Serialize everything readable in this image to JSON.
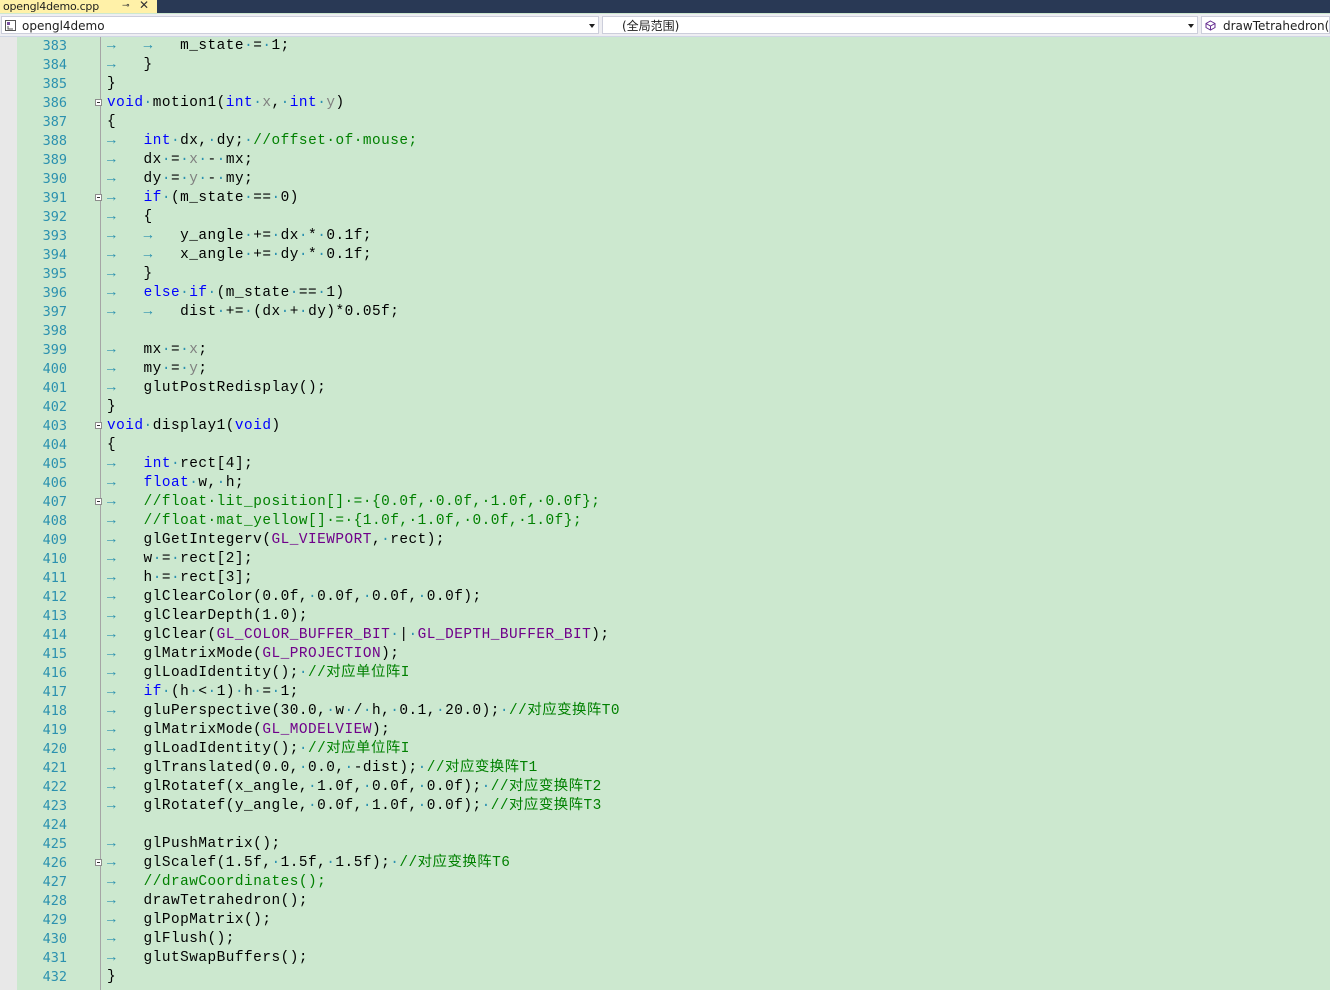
{
  "tab": {
    "title": "opengl4demo.cpp",
    "pin_icon": "⊸",
    "close_icon": "✕"
  },
  "nav": {
    "project": "opengl4demo",
    "scope": "(全局范围)",
    "member": "drawTetrahedron(void)"
  },
  "colors": {
    "background": "#cce8cf",
    "keyword": "#0000ff",
    "comment": "#008000",
    "macro": "#6f008a",
    "line_number": "#2b91af"
  },
  "lines": [
    {
      "n": "383",
      "fold": false,
      "seg": [
        [
          "ar",
          "→"
        ],
        [
          "t",
          "   "
        ],
        [
          "ar",
          "→"
        ],
        [
          "t",
          "   m_state"
        ],
        [
          "dt",
          "·"
        ],
        [
          "t",
          "="
        ],
        [
          "dt",
          "·"
        ],
        [
          "t",
          "1;"
        ]
      ]
    },
    {
      "n": "384",
      "fold": false,
      "seg": [
        [
          "ar",
          "→"
        ],
        [
          "t",
          "   }"
        ]
      ]
    },
    {
      "n": "385",
      "fold": false,
      "seg": [
        [
          "t",
          "}"
        ]
      ]
    },
    {
      "n": "386",
      "fold": true,
      "seg": [
        [
          "kw",
          "void"
        ],
        [
          "dt",
          "·"
        ],
        [
          "t",
          "motion1("
        ],
        [
          "kw",
          "int"
        ],
        [
          "dt",
          "·"
        ],
        [
          "par",
          "x"
        ],
        [
          "t",
          ","
        ],
        [
          "dt",
          "·"
        ],
        [
          "kw",
          "int"
        ],
        [
          "dt",
          "·"
        ],
        [
          "par",
          "y"
        ],
        [
          "t",
          ")"
        ]
      ]
    },
    {
      "n": "387",
      "fold": false,
      "seg": [
        [
          "t",
          "{"
        ]
      ]
    },
    {
      "n": "388",
      "fold": false,
      "seg": [
        [
          "ar",
          "→"
        ],
        [
          "t",
          "   "
        ],
        [
          "kw",
          "int"
        ],
        [
          "dt",
          "·"
        ],
        [
          "t",
          "dx,"
        ],
        [
          "dt",
          "·"
        ],
        [
          "t",
          "dy;"
        ],
        [
          "dt",
          "·"
        ],
        [
          "cm",
          "//offset·of·mouse;"
        ]
      ]
    },
    {
      "n": "389",
      "fold": false,
      "seg": [
        [
          "ar",
          "→"
        ],
        [
          "t",
          "   dx"
        ],
        [
          "dt",
          "·"
        ],
        [
          "t",
          "="
        ],
        [
          "dt",
          "·"
        ],
        [
          "par",
          "x"
        ],
        [
          "dt",
          "·"
        ],
        [
          "t",
          "-"
        ],
        [
          "dt",
          "·"
        ],
        [
          "t",
          "mx;"
        ]
      ]
    },
    {
      "n": "390",
      "fold": false,
      "seg": [
        [
          "ar",
          "→"
        ],
        [
          "t",
          "   dy"
        ],
        [
          "dt",
          "·"
        ],
        [
          "t",
          "="
        ],
        [
          "dt",
          "·"
        ],
        [
          "par",
          "y"
        ],
        [
          "dt",
          "·"
        ],
        [
          "t",
          "-"
        ],
        [
          "dt",
          "·"
        ],
        [
          "t",
          "my;"
        ]
      ]
    },
    {
      "n": "391",
      "fold": true,
      "seg": [
        [
          "ar",
          "→"
        ],
        [
          "t",
          "   "
        ],
        [
          "kw",
          "if"
        ],
        [
          "dt",
          "·"
        ],
        [
          "t",
          "(m_state"
        ],
        [
          "dt",
          "·"
        ],
        [
          "t",
          "=="
        ],
        [
          "dt",
          "·"
        ],
        [
          "t",
          "0)"
        ]
      ]
    },
    {
      "n": "392",
      "fold": false,
      "seg": [
        [
          "ar",
          "→"
        ],
        [
          "t",
          "   {"
        ]
      ]
    },
    {
      "n": "393",
      "fold": false,
      "seg": [
        [
          "ar",
          "→"
        ],
        [
          "t",
          "   "
        ],
        [
          "ar",
          "→"
        ],
        [
          "t",
          "   y_angle"
        ],
        [
          "dt",
          "·"
        ],
        [
          "t",
          "+="
        ],
        [
          "dt",
          "·"
        ],
        [
          "t",
          "dx"
        ],
        [
          "dt",
          "·"
        ],
        [
          "t",
          "*"
        ],
        [
          "dt",
          "·"
        ],
        [
          "t",
          "0.1f;"
        ]
      ]
    },
    {
      "n": "394",
      "fold": false,
      "seg": [
        [
          "ar",
          "→"
        ],
        [
          "t",
          "   "
        ],
        [
          "ar",
          "→"
        ],
        [
          "t",
          "   x_angle"
        ],
        [
          "dt",
          "·"
        ],
        [
          "t",
          "+="
        ],
        [
          "dt",
          "·"
        ],
        [
          "t",
          "dy"
        ],
        [
          "dt",
          "·"
        ],
        [
          "t",
          "*"
        ],
        [
          "dt",
          "·"
        ],
        [
          "t",
          "0.1f;"
        ]
      ]
    },
    {
      "n": "395",
      "fold": false,
      "seg": [
        [
          "ar",
          "→"
        ],
        [
          "t",
          "   }"
        ]
      ]
    },
    {
      "n": "396",
      "fold": false,
      "seg": [
        [
          "ar",
          "→"
        ],
        [
          "t",
          "   "
        ],
        [
          "kw",
          "else"
        ],
        [
          "dt",
          "·"
        ],
        [
          "kw",
          "if"
        ],
        [
          "dt",
          "·"
        ],
        [
          "t",
          "(m_state"
        ],
        [
          "dt",
          "·"
        ],
        [
          "t",
          "=="
        ],
        [
          "dt",
          "·"
        ],
        [
          "t",
          "1)"
        ]
      ]
    },
    {
      "n": "397",
      "fold": false,
      "seg": [
        [
          "ar",
          "→"
        ],
        [
          "t",
          "   "
        ],
        [
          "ar",
          "→"
        ],
        [
          "t",
          "   dist"
        ],
        [
          "dt",
          "·"
        ],
        [
          "t",
          "+="
        ],
        [
          "dt",
          "·"
        ],
        [
          "t",
          "(dx"
        ],
        [
          "dt",
          "·"
        ],
        [
          "t",
          "+"
        ],
        [
          "dt",
          "·"
        ],
        [
          "t",
          "dy)*0.05f;"
        ]
      ]
    },
    {
      "n": "398",
      "fold": false,
      "seg": []
    },
    {
      "n": "399",
      "fold": false,
      "seg": [
        [
          "ar",
          "→"
        ],
        [
          "t",
          "   mx"
        ],
        [
          "dt",
          "·"
        ],
        [
          "t",
          "="
        ],
        [
          "dt",
          "·"
        ],
        [
          "par",
          "x"
        ],
        [
          "t",
          ";"
        ]
      ]
    },
    {
      "n": "400",
      "fold": false,
      "seg": [
        [
          "ar",
          "→"
        ],
        [
          "t",
          "   my"
        ],
        [
          "dt",
          "·"
        ],
        [
          "t",
          "="
        ],
        [
          "dt",
          "·"
        ],
        [
          "par",
          "y"
        ],
        [
          "t",
          ";"
        ]
      ]
    },
    {
      "n": "401",
      "fold": false,
      "seg": [
        [
          "ar",
          "→"
        ],
        [
          "t",
          "   glutPostRedisplay();"
        ]
      ]
    },
    {
      "n": "402",
      "fold": false,
      "seg": [
        [
          "t",
          "}"
        ]
      ]
    },
    {
      "n": "403",
      "fold": true,
      "seg": [
        [
          "kw",
          "void"
        ],
        [
          "dt",
          "·"
        ],
        [
          "t",
          "display1("
        ],
        [
          "kw",
          "void"
        ],
        [
          "t",
          ")"
        ]
      ]
    },
    {
      "n": "404",
      "fold": false,
      "seg": [
        [
          "t",
          "{"
        ]
      ]
    },
    {
      "n": "405",
      "fold": false,
      "seg": [
        [
          "ar",
          "→"
        ],
        [
          "t",
          "   "
        ],
        [
          "kw",
          "int"
        ],
        [
          "dt",
          "·"
        ],
        [
          "t",
          "rect[4];"
        ]
      ]
    },
    {
      "n": "406",
      "fold": false,
      "seg": [
        [
          "ar",
          "→"
        ],
        [
          "t",
          "   "
        ],
        [
          "kw",
          "float"
        ],
        [
          "dt",
          "·"
        ],
        [
          "t",
          "w,"
        ],
        [
          "dt",
          "·"
        ],
        [
          "t",
          "h;"
        ]
      ]
    },
    {
      "n": "407",
      "fold": true,
      "seg": [
        [
          "ar",
          "→"
        ],
        [
          "t",
          "   "
        ],
        [
          "cm",
          "//float·lit_position[]·=·{0.0f,·0.0f,·1.0f,·0.0f};"
        ]
      ]
    },
    {
      "n": "408",
      "fold": false,
      "seg": [
        [
          "ar",
          "→"
        ],
        [
          "t",
          "   "
        ],
        [
          "cm",
          "//float·mat_yellow[]·=·{1.0f,·1.0f,·0.0f,·1.0f};"
        ]
      ]
    },
    {
      "n": "409",
      "fold": false,
      "seg": [
        [
          "ar",
          "→"
        ],
        [
          "t",
          "   glGetIntegerv("
        ],
        [
          "mac",
          "GL_VIEWPORT"
        ],
        [
          "t",
          ","
        ],
        [
          "dt",
          "·"
        ],
        [
          "t",
          "rect);"
        ]
      ]
    },
    {
      "n": "410",
      "fold": false,
      "seg": [
        [
          "ar",
          "→"
        ],
        [
          "t",
          "   w"
        ],
        [
          "dt",
          "·"
        ],
        [
          "t",
          "="
        ],
        [
          "dt",
          "·"
        ],
        [
          "t",
          "rect[2];"
        ]
      ]
    },
    {
      "n": "411",
      "fold": false,
      "seg": [
        [
          "ar",
          "→"
        ],
        [
          "t",
          "   h"
        ],
        [
          "dt",
          "·"
        ],
        [
          "t",
          "="
        ],
        [
          "dt",
          "·"
        ],
        [
          "t",
          "rect[3];"
        ]
      ]
    },
    {
      "n": "412",
      "fold": false,
      "seg": [
        [
          "ar",
          "→"
        ],
        [
          "t",
          "   glClearColor(0.0f,"
        ],
        [
          "dt",
          "·"
        ],
        [
          "t",
          "0.0f,"
        ],
        [
          "dt",
          "·"
        ],
        [
          "t",
          "0.0f,"
        ],
        [
          "dt",
          "·"
        ],
        [
          "t",
          "0.0f);"
        ]
      ]
    },
    {
      "n": "413",
      "fold": false,
      "seg": [
        [
          "ar",
          "→"
        ],
        [
          "t",
          "   glClearDepth(1.0);"
        ]
      ]
    },
    {
      "n": "414",
      "fold": false,
      "seg": [
        [
          "ar",
          "→"
        ],
        [
          "t",
          "   glClear("
        ],
        [
          "mac",
          "GL_COLOR_BUFFER_BIT"
        ],
        [
          "dt",
          "·"
        ],
        [
          "t",
          "|"
        ],
        [
          "dt",
          "·"
        ],
        [
          "mac",
          "GL_DEPTH_BUFFER_BIT"
        ],
        [
          "t",
          ");"
        ]
      ]
    },
    {
      "n": "415",
      "fold": false,
      "seg": [
        [
          "ar",
          "→"
        ],
        [
          "t",
          "   glMatrixMode("
        ],
        [
          "mac",
          "GL_PROJECTION"
        ],
        [
          "t",
          ");"
        ]
      ]
    },
    {
      "n": "416",
      "fold": false,
      "seg": [
        [
          "ar",
          "→"
        ],
        [
          "t",
          "   glLoadIdentity();"
        ],
        [
          "dt",
          "·"
        ],
        [
          "cm",
          "//对应单位阵I"
        ]
      ]
    },
    {
      "n": "417",
      "fold": false,
      "seg": [
        [
          "ar",
          "→"
        ],
        [
          "t",
          "   "
        ],
        [
          "kw",
          "if"
        ],
        [
          "dt",
          "·"
        ],
        [
          "t",
          "(h"
        ],
        [
          "dt",
          "·"
        ],
        [
          "t",
          "<"
        ],
        [
          "dt",
          "·"
        ],
        [
          "t",
          "1)"
        ],
        [
          "dt",
          "·"
        ],
        [
          "t",
          "h"
        ],
        [
          "dt",
          "·"
        ],
        [
          "t",
          "="
        ],
        [
          "dt",
          "·"
        ],
        [
          "t",
          "1;"
        ]
      ]
    },
    {
      "n": "418",
      "fold": false,
      "seg": [
        [
          "ar",
          "→"
        ],
        [
          "t",
          "   gluPerspective(30.0,"
        ],
        [
          "dt",
          "·"
        ],
        [
          "t",
          "w"
        ],
        [
          "dt",
          "·"
        ],
        [
          "t",
          "/"
        ],
        [
          "dt",
          "·"
        ],
        [
          "t",
          "h,"
        ],
        [
          "dt",
          "·"
        ],
        [
          "t",
          "0.1,"
        ],
        [
          "dt",
          "·"
        ],
        [
          "t",
          "20.0);"
        ],
        [
          "dt",
          "·"
        ],
        [
          "cm",
          "//对应变换阵T0"
        ]
      ]
    },
    {
      "n": "419",
      "fold": false,
      "seg": [
        [
          "ar",
          "→"
        ],
        [
          "t",
          "   glMatrixMode("
        ],
        [
          "mac",
          "GL_MODELVIEW"
        ],
        [
          "t",
          ");"
        ]
      ]
    },
    {
      "n": "420",
      "fold": false,
      "seg": [
        [
          "ar",
          "→"
        ],
        [
          "t",
          "   glLoadIdentity();"
        ],
        [
          "dt",
          "·"
        ],
        [
          "cm",
          "//对应单位阵I"
        ]
      ]
    },
    {
      "n": "421",
      "fold": false,
      "seg": [
        [
          "ar",
          "→"
        ],
        [
          "t",
          "   glTranslated(0.0,"
        ],
        [
          "dt",
          "·"
        ],
        [
          "t",
          "0.0,"
        ],
        [
          "dt",
          "·"
        ],
        [
          "t",
          "-dist);"
        ],
        [
          "dt",
          "·"
        ],
        [
          "cm",
          "//对应变换阵T1"
        ]
      ]
    },
    {
      "n": "422",
      "fold": false,
      "seg": [
        [
          "ar",
          "→"
        ],
        [
          "t",
          "   glRotatef(x_angle,"
        ],
        [
          "dt",
          "·"
        ],
        [
          "t",
          "1.0f,"
        ],
        [
          "dt",
          "·"
        ],
        [
          "t",
          "0.0f,"
        ],
        [
          "dt",
          "·"
        ],
        [
          "t",
          "0.0f);"
        ],
        [
          "dt",
          "·"
        ],
        [
          "cm",
          "//对应变换阵T2"
        ]
      ]
    },
    {
      "n": "423",
      "fold": false,
      "seg": [
        [
          "ar",
          "→"
        ],
        [
          "t",
          "   glRotatef(y_angle,"
        ],
        [
          "dt",
          "·"
        ],
        [
          "t",
          "0.0f,"
        ],
        [
          "dt",
          "·"
        ],
        [
          "t",
          "1.0f,"
        ],
        [
          "dt",
          "·"
        ],
        [
          "t",
          "0.0f);"
        ],
        [
          "dt",
          "·"
        ],
        [
          "cm",
          "//对应变换阵T3"
        ]
      ]
    },
    {
      "n": "424",
      "fold": false,
      "seg": []
    },
    {
      "n": "425",
      "fold": false,
      "seg": [
        [
          "ar",
          "→"
        ],
        [
          "t",
          "   glPushMatrix();"
        ]
      ]
    },
    {
      "n": "426",
      "fold": true,
      "seg": [
        [
          "ar",
          "→"
        ],
        [
          "t",
          "   glScalef(1.5f,"
        ],
        [
          "dt",
          "·"
        ],
        [
          "t",
          "1.5f,"
        ],
        [
          "dt",
          "·"
        ],
        [
          "t",
          "1.5f);"
        ],
        [
          "dt",
          "·"
        ],
        [
          "cm",
          "//对应变换阵T6"
        ]
      ]
    },
    {
      "n": "427",
      "fold": false,
      "seg": [
        [
          "ar",
          "→"
        ],
        [
          "t",
          "   "
        ],
        [
          "cm",
          "//drawCoordinates();"
        ]
      ]
    },
    {
      "n": "428",
      "fold": false,
      "seg": [
        [
          "ar",
          "→"
        ],
        [
          "t",
          "   drawTetrahedron();"
        ]
      ]
    },
    {
      "n": "429",
      "fold": false,
      "seg": [
        [
          "ar",
          "→"
        ],
        [
          "t",
          "   glPopMatrix();"
        ]
      ]
    },
    {
      "n": "430",
      "fold": false,
      "seg": [
        [
          "ar",
          "→"
        ],
        [
          "t",
          "   glFlush();"
        ]
      ]
    },
    {
      "n": "431",
      "fold": false,
      "seg": [
        [
          "ar",
          "→"
        ],
        [
          "t",
          "   glutSwapBuffers();"
        ]
      ]
    },
    {
      "n": "432",
      "fold": false,
      "seg": [
        [
          "t",
          "}"
        ]
      ]
    }
  ]
}
